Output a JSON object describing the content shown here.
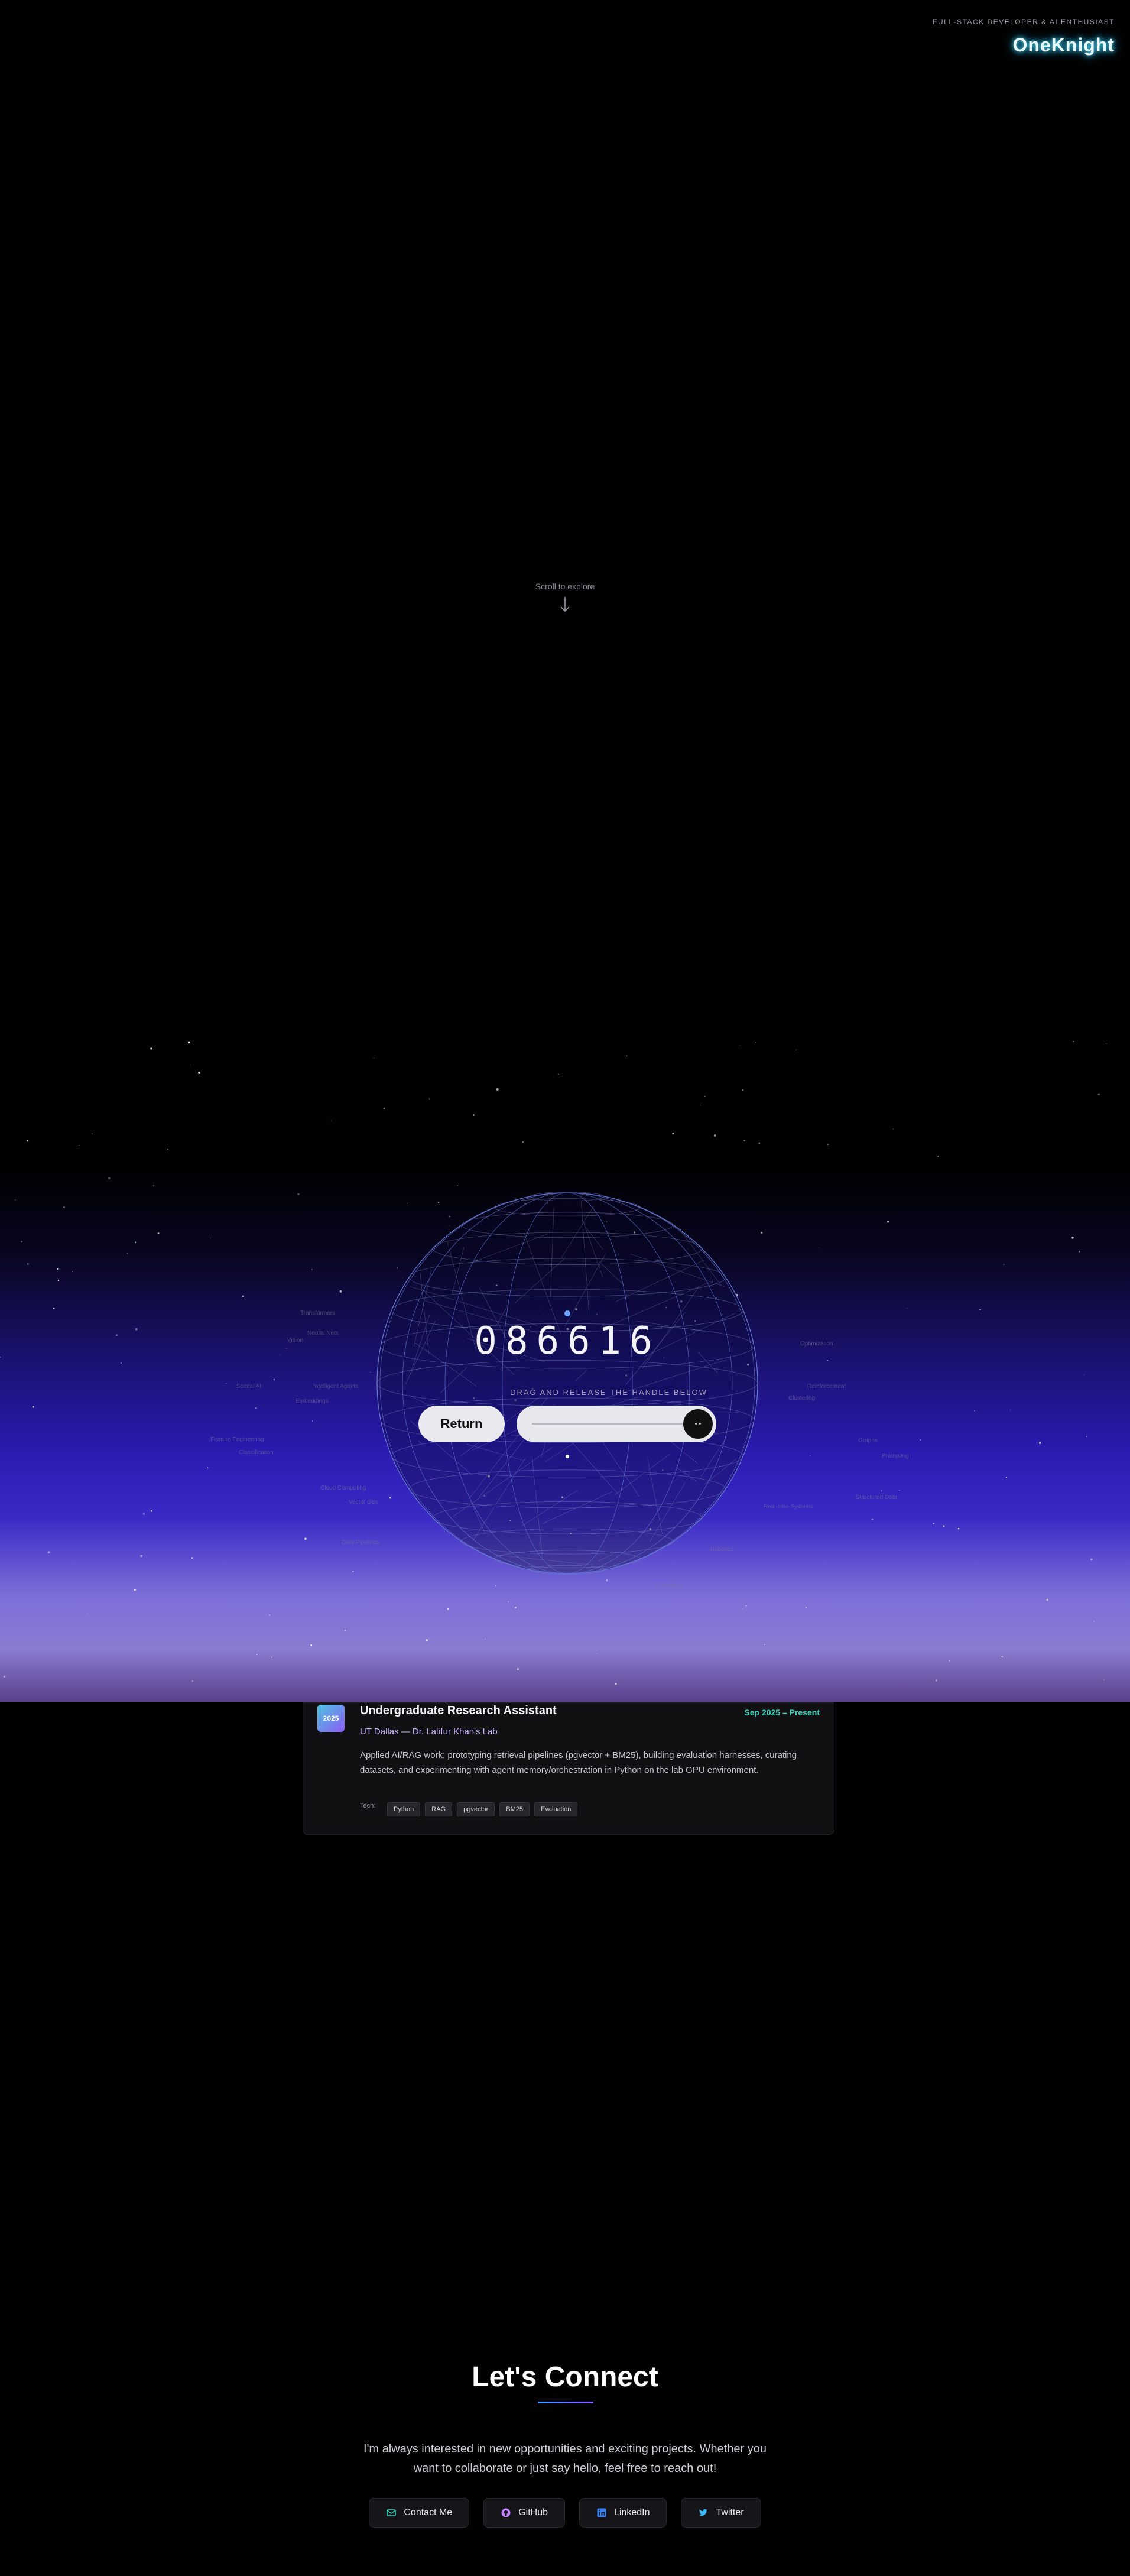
{
  "header": {
    "tagline": "FULL-STACK DEVELOPER & AI ENTHUSIAST",
    "brand": "OneKnight"
  },
  "hero": {
    "scroll_hint": "Scroll to explore"
  },
  "galaxy": {
    "counter": "086616",
    "hint": "DRAG AND RELEASE THE HANDLE BELOW",
    "return_label": "Return",
    "handle_label": "• •",
    "ghost_labels": [
      "Transformers",
      "Neural Nets",
      "Vision",
      "Spatial AI",
      "Intelligent Agents",
      "Embeddings",
      "Feature Engineering",
      "Classification",
      "Cloud Computing",
      "Data Pipelines",
      "Vector DBs",
      "Optimization",
      "Reinforcement",
      "Clustering",
      "Graphs",
      "Prompting",
      "Structured Data",
      "Real-time Systems",
      "Robotics",
      "Evaluation"
    ]
  },
  "experience": {
    "year_badge": "2025",
    "role": "Undergraduate Research Assistant",
    "dates": "Sep 2025 – Present",
    "org": "UT Dallas — Dr. Latifur Khan's Lab",
    "description": "Applied AI/RAG work: prototyping retrieval pipelines (pgvector + BM25), building evaluation harnesses, curating datasets, and experimenting with agent memory/orchestration in Python on the lab GPU environment.",
    "tech_label": "Tech:",
    "tags": [
      "Python",
      "RAG",
      "pgvector",
      "BM25",
      "Evaluation"
    ]
  },
  "connect": {
    "title": "Let's Connect",
    "text": "I'm always interested in new opportunities and exciting projects. Whether you want to collaborate or just say hello, feel free to reach out!",
    "links": [
      {
        "label": "Contact Me",
        "icon": "mail-icon",
        "color": "#2ed3b7"
      },
      {
        "label": "GitHub",
        "icon": "github-icon",
        "color": "#c084fc"
      },
      {
        "label": "LinkedIn",
        "icon": "linkedin-icon",
        "color": "#3b82f6"
      },
      {
        "label": "Twitter",
        "icon": "twitter-icon",
        "color": "#38bdf8"
      }
    ]
  },
  "colors": {
    "accent_teal": "#2ed3b7",
    "accent_purple": "#c9b4ff",
    "brand_glow": "#4ee0ff"
  }
}
